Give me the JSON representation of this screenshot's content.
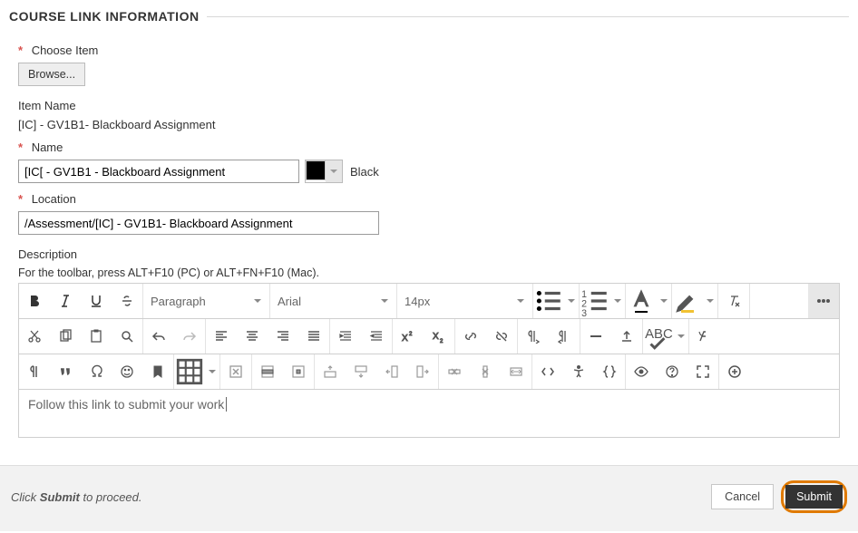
{
  "header": {
    "title": "COURSE LINK INFORMATION"
  },
  "chooseItem": {
    "label": "Choose Item",
    "browse_label": "Browse..."
  },
  "itemName": {
    "label": "Item Name",
    "value": "[IC] - GV1B1- Blackboard Assignment"
  },
  "name": {
    "label": "Name",
    "value": "[IC[ - GV1B1 - Blackboard Assignment",
    "color_label": "Black",
    "color_hex": "#000000"
  },
  "location": {
    "label": "Location",
    "value": "/Assessment/[IC] - GV1B1- Blackboard Assignment"
  },
  "description": {
    "label": "Description",
    "help": "For the toolbar, press ALT+F10 (PC) or ALT+FN+F10 (Mac)."
  },
  "editor": {
    "block_format": "Paragraph",
    "font_family": "Arial",
    "font_size": "14px",
    "content": "Follow this link to submit your work"
  },
  "footer": {
    "msg_prefix": "Click ",
    "msg_bold": "Submit",
    "msg_suffix": " to proceed.",
    "cancel_label": "Cancel",
    "submit_label": "Submit"
  }
}
